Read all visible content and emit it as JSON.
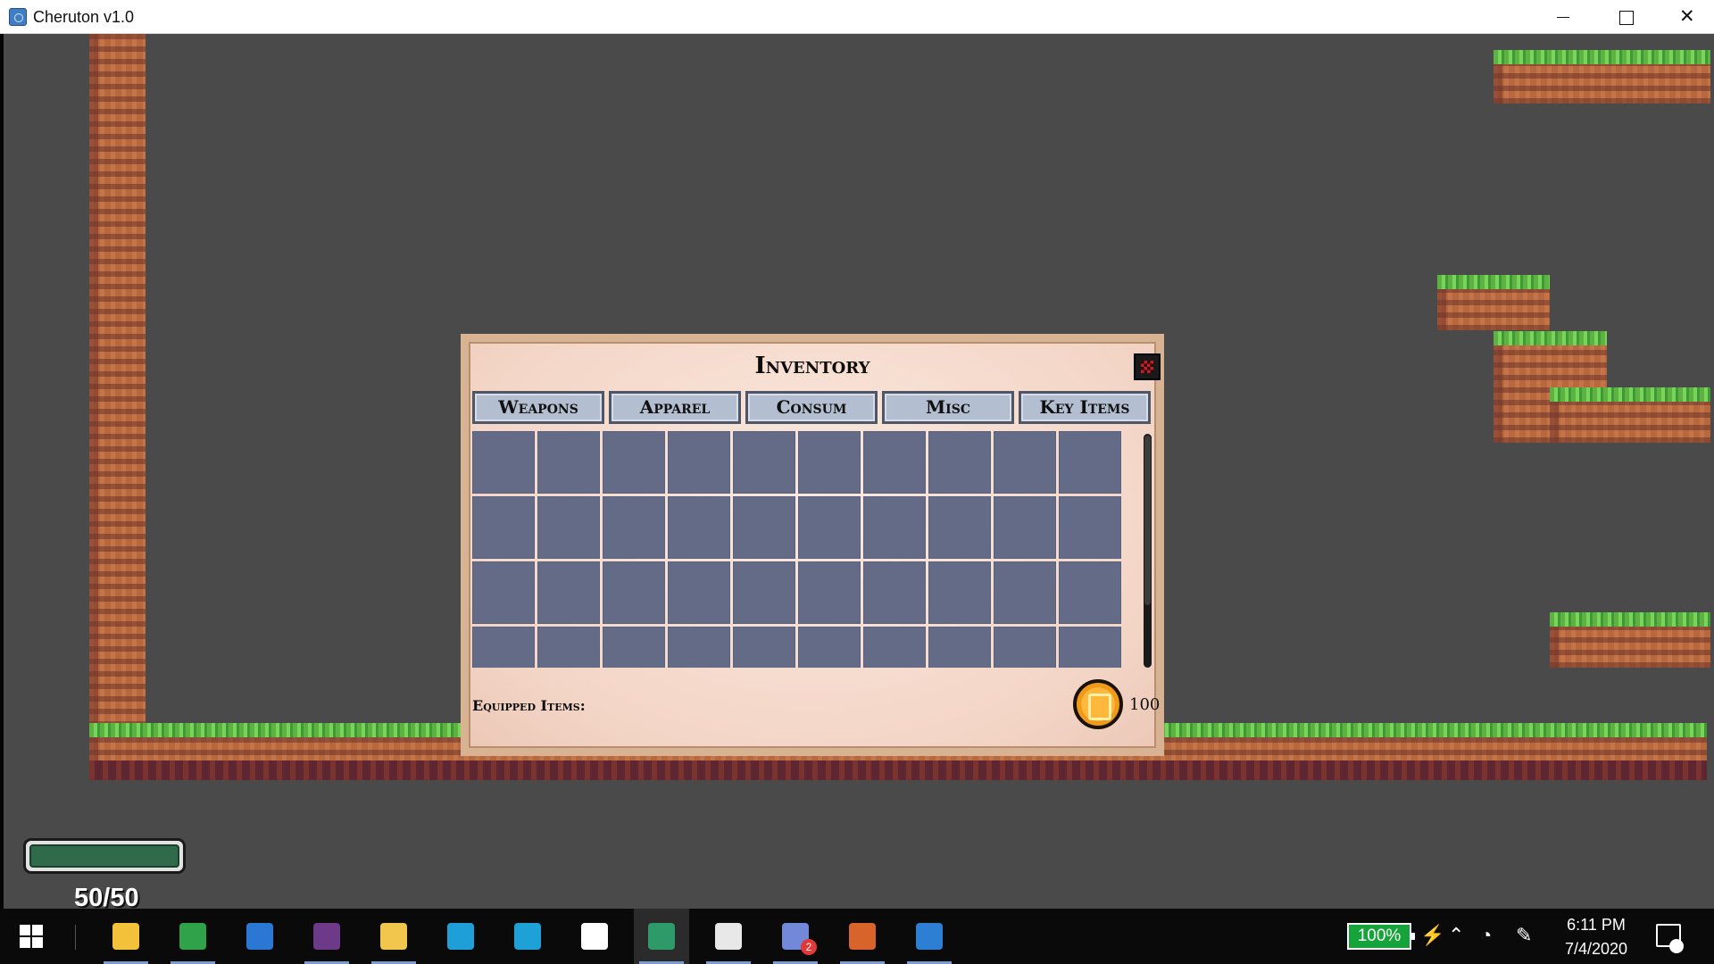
{
  "window": {
    "title": "Cheruton v1.0",
    "minimize_icon": "minimize-icon",
    "maximize_icon": "maximize-icon",
    "close_glyph": "✕"
  },
  "inventory": {
    "title": "Inventory",
    "tabs": [
      {
        "label": "Weapons"
      },
      {
        "label": "Apparel"
      },
      {
        "label": "Consum"
      },
      {
        "label": "Misc"
      },
      {
        "label": "Key Items"
      }
    ],
    "slot_columns": 10,
    "visible_rows": 4,
    "equipped_label": "Equipped Items:",
    "coins": "100",
    "close_icon": "close-icon"
  },
  "hud": {
    "health_text": "50/50",
    "health_fraction": 1.0,
    "health_color": "#2f6a4a"
  },
  "taskbar": {
    "apps": [
      {
        "name": "linux-icon",
        "color": "#f4c23a",
        "running": true
      },
      {
        "name": "chrome-icon",
        "color": "#2fa24a",
        "running": true
      },
      {
        "name": "mail-icon",
        "color": "#2a78d4",
        "running": false
      },
      {
        "name": "game-launcher-icon",
        "color": "#6d3a8a",
        "running": true
      },
      {
        "name": "file-explorer-icon",
        "color": "#f2c64c",
        "running": true
      },
      {
        "name": "edge-icon",
        "color": "#1f9fd8",
        "running": false
      },
      {
        "name": "whatsapp-icon",
        "color": "#1da1d6",
        "running": false
      },
      {
        "name": "settings-icon",
        "color": "#ffffff",
        "running": false
      },
      {
        "name": "game-window-icon",
        "color": "#2e9a6a",
        "running": true,
        "active": true
      },
      {
        "name": "terminal-icon",
        "color": "#e8e8e8",
        "running": true
      },
      {
        "name": "discord-icon",
        "color": "#7289da",
        "running": true,
        "badge": "2"
      },
      {
        "name": "media-player-icon",
        "color": "#d8632b",
        "running": true
      },
      {
        "name": "photos-icon",
        "color": "#2d7fd4",
        "running": true
      }
    ],
    "battery": "100%",
    "time": "6:11 PM",
    "date": "7/4/2020"
  }
}
